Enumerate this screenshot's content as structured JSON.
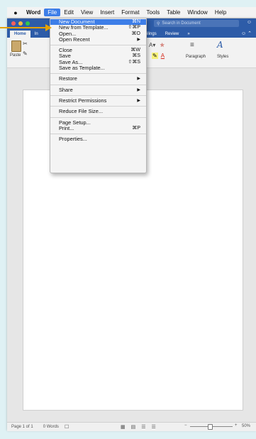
{
  "menubar": {
    "app": "Word",
    "items": [
      "File",
      "Edit",
      "View",
      "Insert",
      "Format",
      "Tools",
      "Table",
      "Window",
      "Help"
    ]
  },
  "window": {
    "search_placeholder": "Search in Document",
    "tabs": [
      "Home",
      "In",
      "s",
      "Mailings",
      "Review",
      "»"
    ],
    "ribbon": {
      "paste_label": "Paste",
      "paragraph_label": "Paragraph",
      "styles_label": "Styles"
    }
  },
  "file_menu": {
    "groups": [
      [
        {
          "label": "New Document",
          "shortcut": "⌘N",
          "highlighted": true
        },
        {
          "label": "New from Template...",
          "shortcut": "⇧⌘P"
        },
        {
          "label": "Open...",
          "shortcut": "⌘O"
        },
        {
          "label": "Open Recent",
          "submenu": true
        }
      ],
      [
        {
          "label": "Close",
          "shortcut": "⌘W"
        },
        {
          "label": "Save",
          "shortcut": "⌘S"
        },
        {
          "label": "Save As...",
          "shortcut": "⇧⌘S"
        },
        {
          "label": "Save as Template..."
        }
      ],
      [
        {
          "label": "Restore",
          "submenu": true
        }
      ],
      [
        {
          "label": "Share",
          "submenu": true
        }
      ],
      [
        {
          "label": "Restrict Permissions",
          "submenu": true
        }
      ],
      [
        {
          "label": "Reduce File Size..."
        }
      ],
      [
        {
          "label": "Page Setup..."
        },
        {
          "label": "Print...",
          "shortcut": "⌘P"
        }
      ],
      [
        {
          "label": "Properties..."
        }
      ]
    ]
  },
  "statusbar": {
    "page": "Page 1 of 1",
    "words": "0 Words",
    "zoom": "50%"
  },
  "colors": {
    "accent": "#2d5ca8",
    "menu_highlight": "#3d7ee8",
    "callout": "#e5a200"
  }
}
